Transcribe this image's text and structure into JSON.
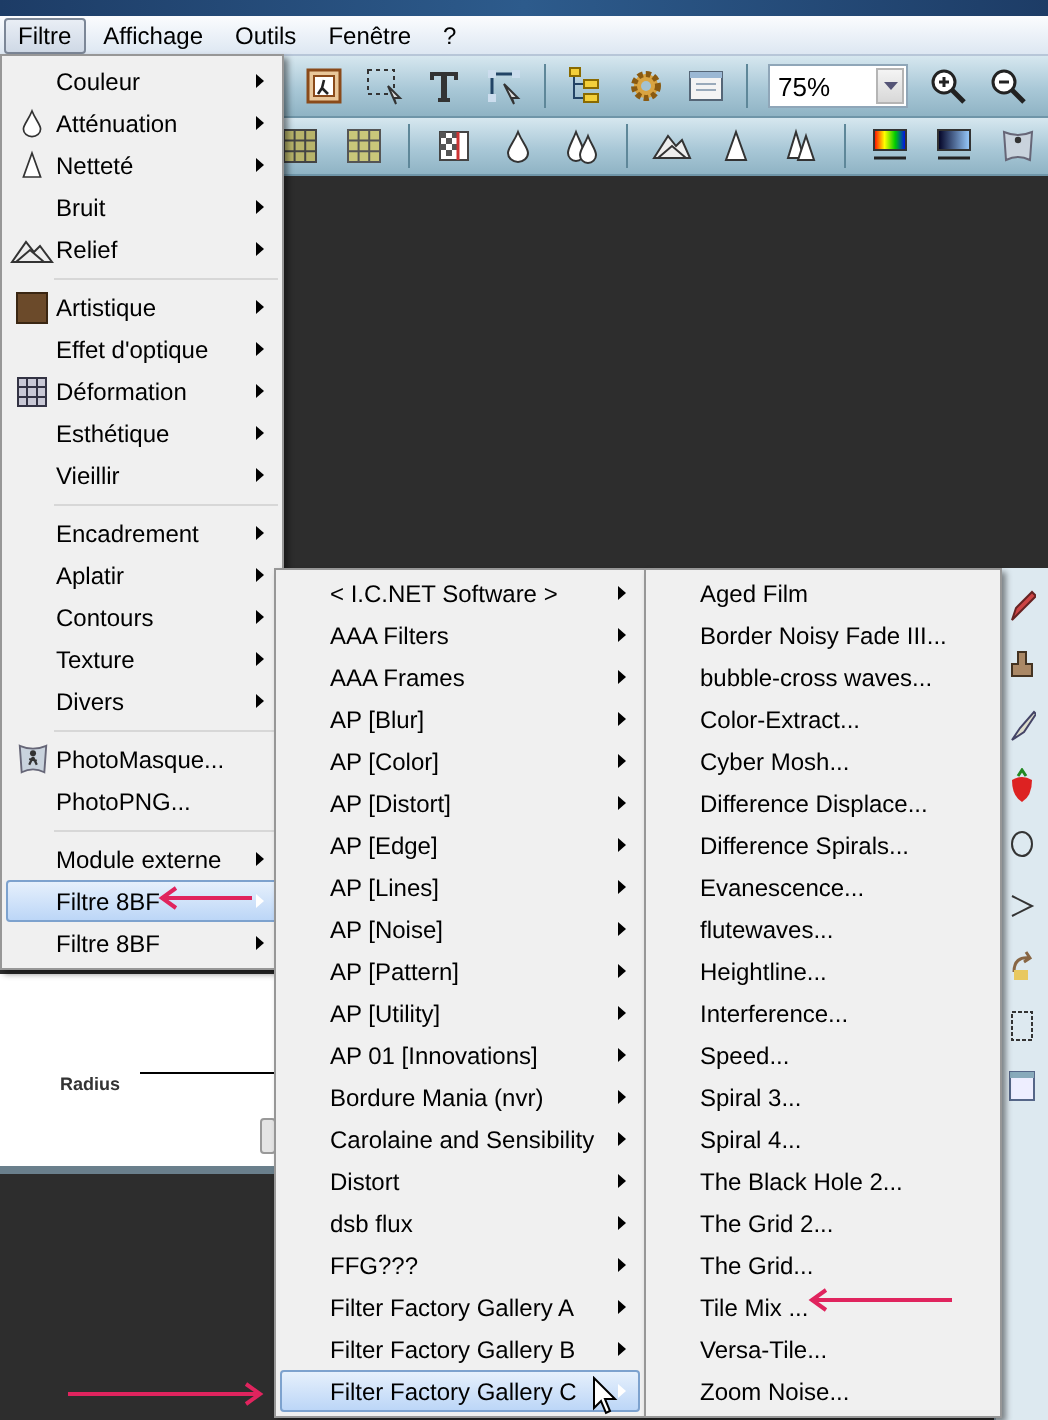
{
  "menubar": [
    {
      "label": "Filtre",
      "selected": true
    },
    {
      "label": "Affichage",
      "selected": false
    },
    {
      "label": "Outils",
      "selected": false
    },
    {
      "label": "Fenêtre",
      "selected": false
    },
    {
      "label": "?",
      "selected": false
    }
  ],
  "toolbar": {
    "zoom": "75%"
  },
  "dialog": {
    "label": "Radius"
  },
  "menu": {
    "items": [
      {
        "kind": "item",
        "label": "Couleur",
        "submenu": true,
        "selected": false
      },
      {
        "kind": "item",
        "label": "Atténuation",
        "submenu": true,
        "selected": false
      },
      {
        "kind": "item",
        "label": "Netteté",
        "submenu": true,
        "selected": false
      },
      {
        "kind": "item",
        "label": "Bruit",
        "submenu": true,
        "selected": false
      },
      {
        "kind": "item",
        "label": "Relief",
        "submenu": true,
        "selected": false
      },
      {
        "kind": "separator"
      },
      {
        "kind": "item",
        "label": "Artistique",
        "submenu": true,
        "selected": false
      },
      {
        "kind": "item",
        "label": "Effet d'optique",
        "submenu": true,
        "selected": false
      },
      {
        "kind": "item",
        "label": "Déformation",
        "submenu": true,
        "selected": false
      },
      {
        "kind": "item",
        "label": "Esthétique",
        "submenu": true,
        "selected": false
      },
      {
        "kind": "item",
        "label": "Vieillir",
        "submenu": true,
        "selected": false
      },
      {
        "kind": "separator"
      },
      {
        "kind": "item",
        "label": "Encadrement",
        "submenu": true,
        "selected": false
      },
      {
        "kind": "item",
        "label": "Aplatir",
        "submenu": true,
        "selected": false
      },
      {
        "kind": "item",
        "label": "Contours",
        "submenu": true,
        "selected": false
      },
      {
        "kind": "item",
        "label": "Texture",
        "submenu": true,
        "selected": false
      },
      {
        "kind": "item",
        "label": "Divers",
        "submenu": true,
        "selected": false
      },
      {
        "kind": "separator"
      },
      {
        "kind": "item",
        "label": "PhotoMasque...",
        "submenu": false,
        "selected": false
      },
      {
        "kind": "item",
        "label": "PhotoPNG...",
        "submenu": false,
        "selected": false
      },
      {
        "kind": "separator"
      },
      {
        "kind": "item",
        "label": "Module externe",
        "submenu": true,
        "selected": false
      },
      {
        "kind": "item",
        "label": "Filtre 8BF",
        "submenu": true,
        "selected": true
      },
      {
        "kind": "item",
        "label": "Filtre 8BF",
        "submenu": true,
        "selected": false
      }
    ]
  },
  "submenu_1": {
    "items": [
      {
        "kind": "item",
        "label": "< I.C.NET Software >",
        "submenu": true,
        "selected": false
      },
      {
        "kind": "item",
        "label": "AAA Filters",
        "submenu": true,
        "selected": false
      },
      {
        "kind": "item",
        "label": "AAA Frames",
        "submenu": true,
        "selected": false
      },
      {
        "kind": "item",
        "label": "AP [Blur]",
        "submenu": true,
        "selected": false
      },
      {
        "kind": "item",
        "label": "AP [Color]",
        "submenu": true,
        "selected": false
      },
      {
        "kind": "item",
        "label": "AP [Distort]",
        "submenu": true,
        "selected": false
      },
      {
        "kind": "item",
        "label": "AP [Edge]",
        "submenu": true,
        "selected": false
      },
      {
        "kind": "item",
        "label": "AP [Lines]",
        "submenu": true,
        "selected": false
      },
      {
        "kind": "item",
        "label": "AP [Noise]",
        "submenu": true,
        "selected": false
      },
      {
        "kind": "item",
        "label": "AP [Pattern]",
        "submenu": true,
        "selected": false
      },
      {
        "kind": "item",
        "label": "AP [Utility]",
        "submenu": true,
        "selected": false
      },
      {
        "kind": "item",
        "label": "AP 01 [Innovations]",
        "submenu": true,
        "selected": false
      },
      {
        "kind": "item",
        "label": "Bordure Mania (nvr)",
        "submenu": true,
        "selected": false
      },
      {
        "kind": "item",
        "label": "Carolaine and Sensibility",
        "submenu": true,
        "selected": false
      },
      {
        "kind": "item",
        "label": "Distort",
        "submenu": true,
        "selected": false
      },
      {
        "kind": "item",
        "label": "dsb flux",
        "submenu": true,
        "selected": false
      },
      {
        "kind": "item",
        "label": "FFG???",
        "submenu": true,
        "selected": false
      },
      {
        "kind": "item",
        "label": "Filter Factory Gallery A",
        "submenu": true,
        "selected": false
      },
      {
        "kind": "item",
        "label": "Filter Factory Gallery B",
        "submenu": true,
        "selected": false
      },
      {
        "kind": "item",
        "label": "Filter Factory Gallery C",
        "submenu": true,
        "selected": true
      }
    ]
  },
  "submenu_2": {
    "items": [
      {
        "kind": "item",
        "label": "Aged Film",
        "submenu": false,
        "selected": false
      },
      {
        "kind": "item",
        "label": "Border Noisy Fade III...",
        "submenu": false,
        "selected": false
      },
      {
        "kind": "item",
        "label": "bubble-cross waves...",
        "submenu": false,
        "selected": false
      },
      {
        "kind": "item",
        "label": "Color-Extract...",
        "submenu": false,
        "selected": false
      },
      {
        "kind": "item",
        "label": "Cyber Mosh...",
        "submenu": false,
        "selected": false
      },
      {
        "kind": "item",
        "label": "Difference Displace...",
        "submenu": false,
        "selected": false
      },
      {
        "kind": "item",
        "label": "Difference Spirals...",
        "submenu": false,
        "selected": false
      },
      {
        "kind": "item",
        "label": "Evanescence...",
        "submenu": false,
        "selected": false
      },
      {
        "kind": "item",
        "label": "flutewaves...",
        "submenu": false,
        "selected": false
      },
      {
        "kind": "item",
        "label": "Heightline...",
        "submenu": false,
        "selected": false
      },
      {
        "kind": "item",
        "label": "Interference...",
        "submenu": false,
        "selected": false
      },
      {
        "kind": "item",
        "label": "Speed...",
        "submenu": false,
        "selected": false
      },
      {
        "kind": "item",
        "label": "Spiral 3...",
        "submenu": false,
        "selected": false
      },
      {
        "kind": "item",
        "label": "Spiral 4...",
        "submenu": false,
        "selected": false
      },
      {
        "kind": "item",
        "label": "The Black Hole 2...",
        "submenu": false,
        "selected": false
      },
      {
        "kind": "item",
        "label": "The Grid 2...",
        "submenu": false,
        "selected": false
      },
      {
        "kind": "item",
        "label": "The Grid...",
        "submenu": false,
        "selected": false
      },
      {
        "kind": "item",
        "label": "Tile Mix ...",
        "submenu": false,
        "selected": false
      },
      {
        "kind": "item",
        "label": "Versa-Tile...",
        "submenu": false,
        "selected": false
      },
      {
        "kind": "item",
        "label": "Zoom Noise...",
        "submenu": false,
        "selected": false
      }
    ]
  }
}
